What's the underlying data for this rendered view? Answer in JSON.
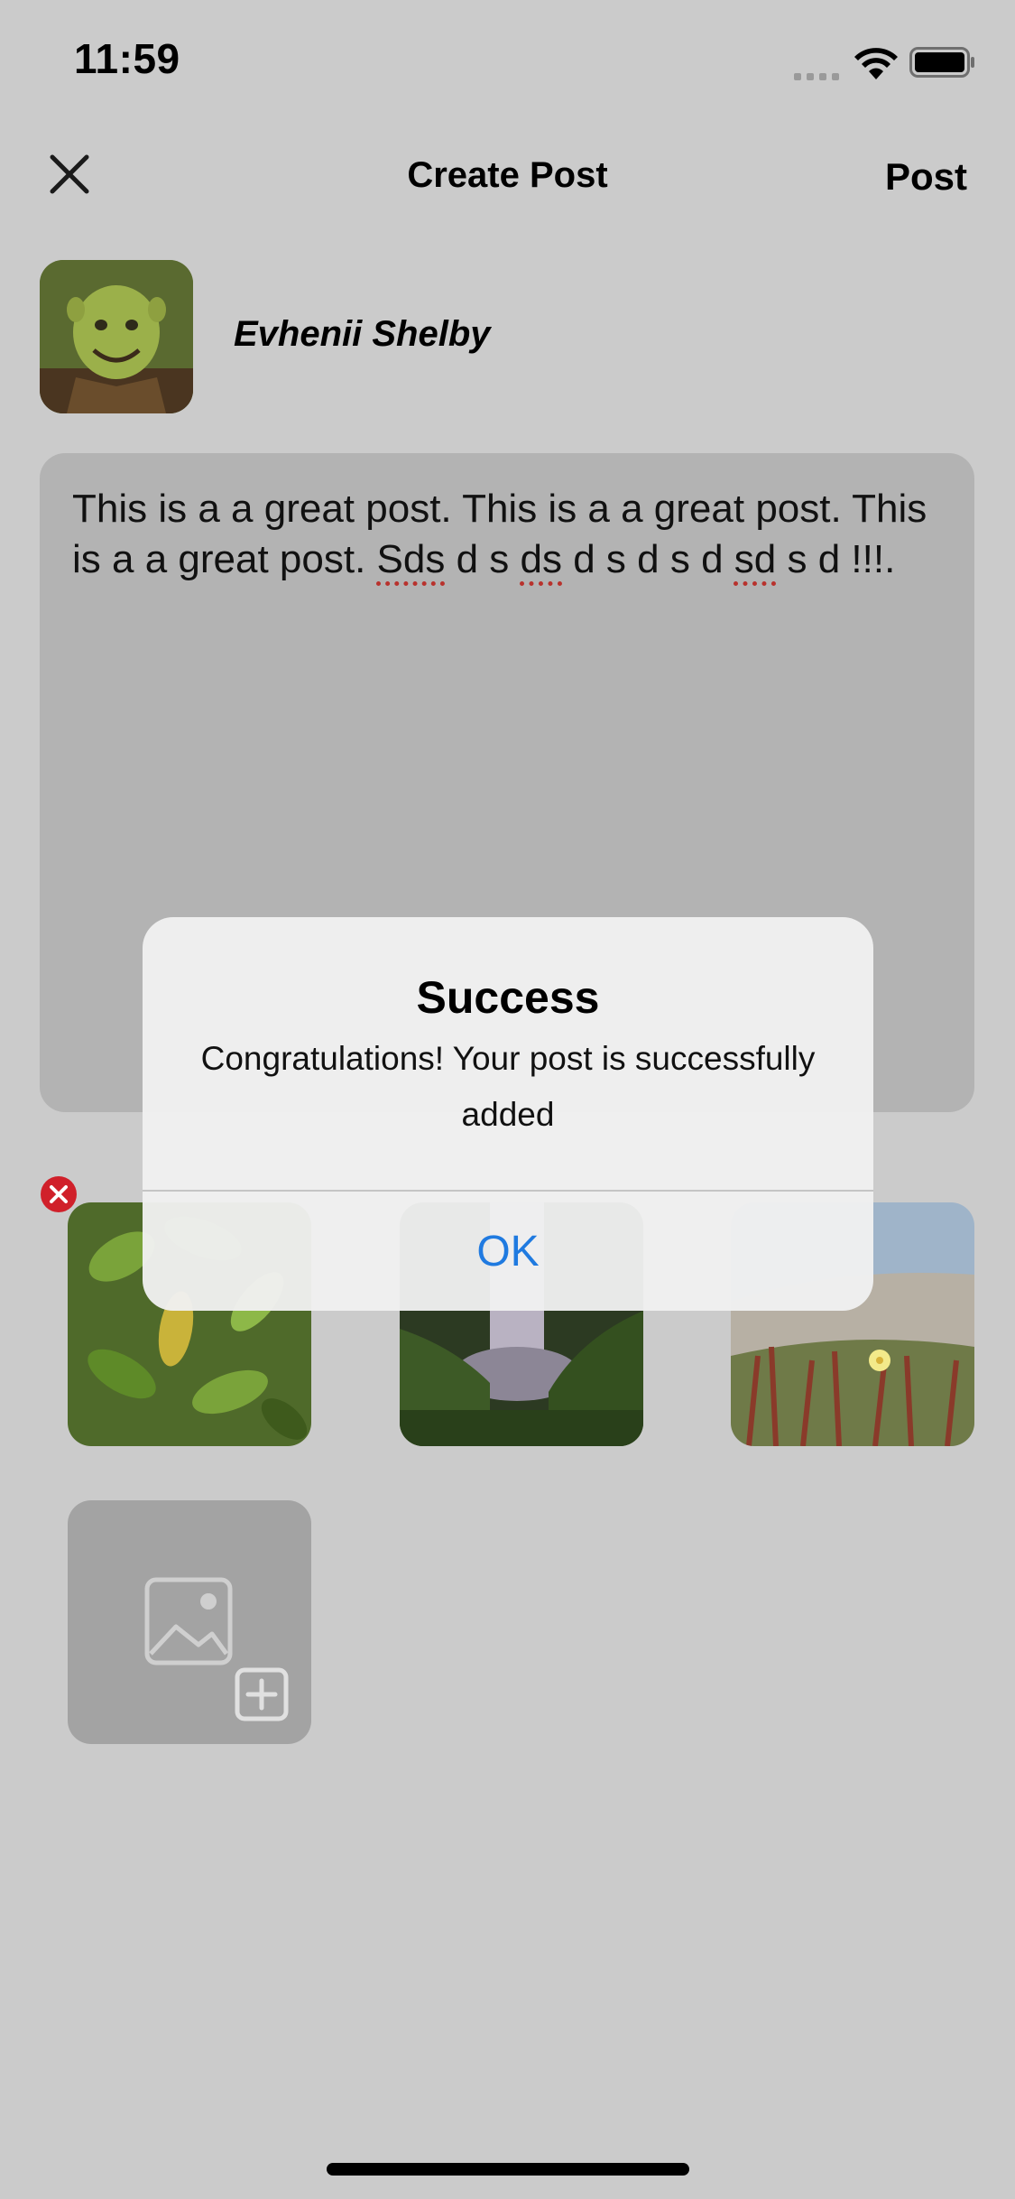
{
  "status_bar": {
    "time": "11:59"
  },
  "nav": {
    "title": "Create Post",
    "post_label": "Post",
    "close_icon": "close-icon"
  },
  "author": {
    "name": "Evhenii Shelby"
  },
  "post": {
    "text_part1": "This is a a great post. This is a a great post. This is a a great post. ",
    "text_sds": "Sds",
    "text_part2": " d s ",
    "text_ds": "ds",
    "text_part3": " d s d s d ",
    "text_sd": "sd",
    "text_part4": " s d !!!."
  },
  "photos": [
    {
      "name": "leaves"
    },
    {
      "name": "waterfall"
    },
    {
      "name": "flower-dunes"
    }
  ],
  "alert": {
    "title": "Success",
    "message": "Congratulations! Your post is successfully added",
    "ok_label": "OK"
  },
  "colors": {
    "accent": "#1f7ae0",
    "remove": "#d0202a",
    "background": "#cbcbcb"
  }
}
